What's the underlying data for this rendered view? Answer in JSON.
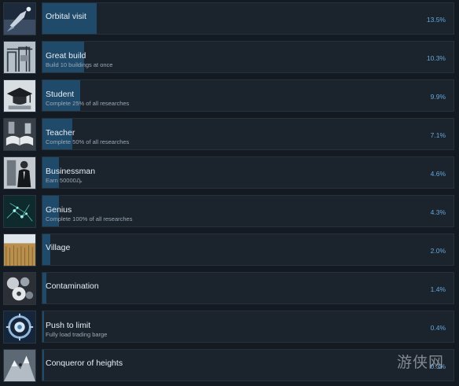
{
  "achievements": [
    {
      "title": "Orbital visit",
      "description": "",
      "percent_label": "13.5%",
      "percent": 13.5,
      "icon": "rocket-launch-icon"
    },
    {
      "title": "Great build",
      "description": "Build 10 buildings at once",
      "percent_label": "10.3%",
      "percent": 10.3,
      "icon": "construction-site-icon"
    },
    {
      "title": "Student",
      "description": "Complete 25% of all researches",
      "percent_label": "9.9%",
      "percent": 9.9,
      "icon": "graduation-cap-icon"
    },
    {
      "title": "Teacher",
      "description": "Complete 50% of all researches",
      "percent_label": "7.1%",
      "percent": 7.1,
      "icon": "open-book-icon"
    },
    {
      "title": "Businessman",
      "description": "Earn 50000₯",
      "percent_label": "4.6%",
      "percent": 4.6,
      "icon": "businessman-icon"
    },
    {
      "title": "Genius",
      "description": "Complete 100% of all researches",
      "percent_label": "4.3%",
      "percent": 4.3,
      "icon": "neural-network-icon"
    },
    {
      "title": "Village",
      "description": "",
      "percent_label": "2.0%",
      "percent": 2.0,
      "icon": "wheat-field-icon"
    },
    {
      "title": "Contamination",
      "description": "",
      "percent_label": "1.4%",
      "percent": 1.4,
      "icon": "contamination-icon"
    },
    {
      "title": "Push to limit",
      "description": "Fully load trading barge",
      "percent_label": "0.4%",
      "percent": 0.4,
      "icon": "reactor-icon"
    },
    {
      "title": "Conqueror of heights",
      "description": "",
      "percent_label": "0.3%",
      "percent": 0.3,
      "icon": "mountain-climber-icon"
    }
  ],
  "watermark": {
    "text": "游侠网"
  },
  "colors": {
    "background": "#141a22",
    "panel": "#1b232d",
    "progress_fill": "#1f4a6a",
    "percent_text": "#66a8dc"
  }
}
